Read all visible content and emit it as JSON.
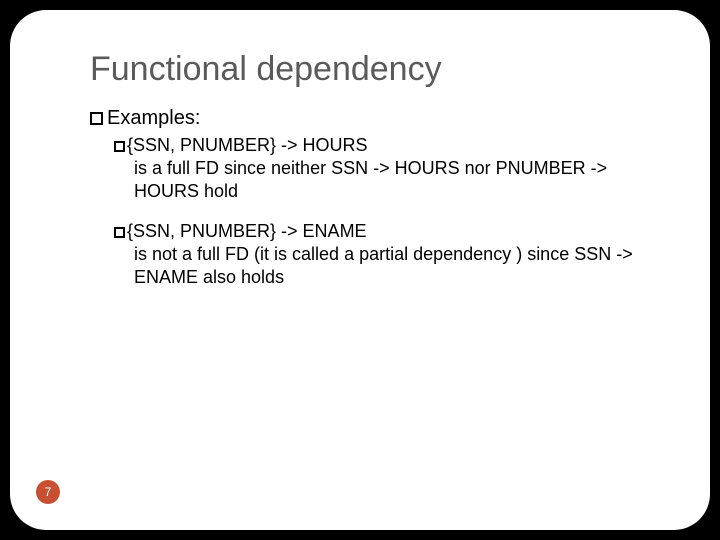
{
  "title": "Functional dependency",
  "level1_label": "Examples:",
  "ex1": {
    "fd": "{SSN, PNUMBER} -> HOURS",
    "desc": "is a full FD since neither SSN -> HOURS nor PNUMBER -> HOURS hold"
  },
  "ex2": {
    "fd": "{SSN, PNUMBER} -> ENAME",
    "desc": "is not  a full FD (it is called a partial dependency ) since SSN -> ENAME also holds"
  },
  "page_number": "7"
}
